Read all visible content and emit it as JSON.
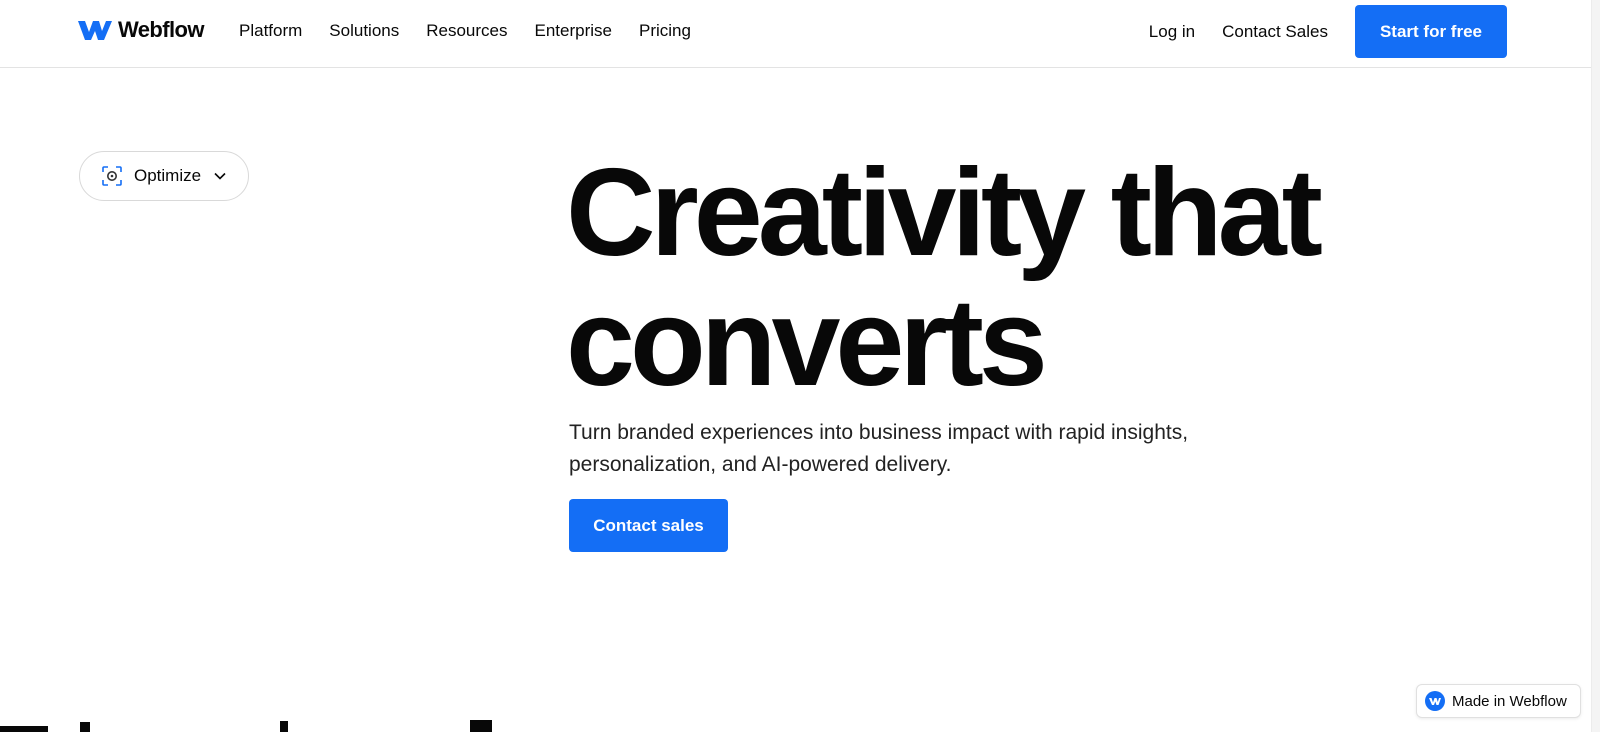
{
  "header": {
    "brand": "Webflow",
    "logo_icon": "webflow-logo-icon",
    "nav": [
      {
        "label": "Platform"
      },
      {
        "label": "Solutions"
      },
      {
        "label": "Resources"
      },
      {
        "label": "Enterprise"
      },
      {
        "label": "Pricing"
      }
    ],
    "login_label": "Log in",
    "contact_sales_label": "Contact Sales",
    "cta_label": "Start for free"
  },
  "selector": {
    "icon": "focus-target-icon",
    "label": "Optimize",
    "chevron": "chevron-down-icon"
  },
  "hero": {
    "title_line1": "Creativity that",
    "title_line2": "converts",
    "subtitle": "Turn branded experiences into business impact with rapid insights, personalization, and AI-powered delivery.",
    "cta_label": "Contact sales"
  },
  "badge": {
    "icon": "webflow-badge-icon",
    "label": "Made in Webflow"
  },
  "colors": {
    "accent": "#146ef5",
    "text": "#080808",
    "border": "#e3e3e3"
  }
}
